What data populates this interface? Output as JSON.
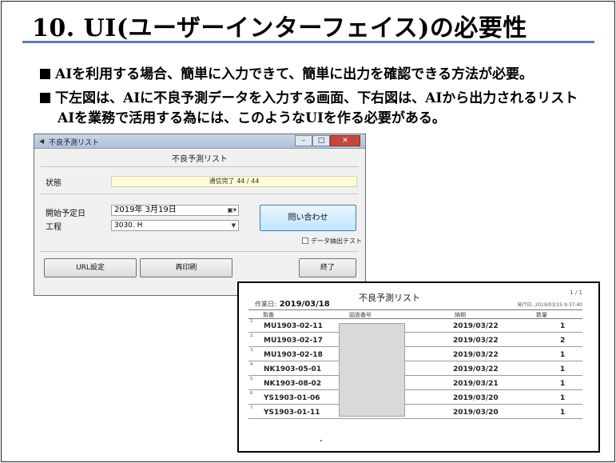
{
  "slide": {
    "title": "10. UI(ユーザーインターフェイス)の必要性",
    "bullets": [
      "AIを利用する場合、簡単に入力できて、簡単に出力を確認できる方法が必要。",
      "下左図は、AIに不良予測データを入力する画面、下右図は、AIから出力されるリスト",
      "AIを業務で活用する為には、このようなUIを作る必要がある。"
    ]
  },
  "window": {
    "title": "不良予測リスト",
    "header": "不良予測リスト",
    "status_label": "状態",
    "status_value": "通信完了 44 / 44",
    "start_date_label": "開始予定日",
    "start_date_value": "2019年  3月19日",
    "process_label": "工程",
    "process_value": "3030. H",
    "query_button": "問い合わせ",
    "test_checkbox": "データ抽出テスト",
    "url_button": "URL設定",
    "reprint_button": "再印刷",
    "end_button": "終了"
  },
  "report": {
    "title": "不良予測リスト",
    "page": "1 / 1",
    "work_date_label": "作業日:",
    "work_date": "2019/03/18",
    "issue_label": "発行日:",
    "issue_date": "2019/03/15 9:37:40",
    "columns": [
      "製番",
      "図面番号",
      "納期",
      "数量"
    ],
    "rows": [
      {
        "no": "1.",
        "part": "MU1903-02-11",
        "due": "2019/03/22",
        "qty": "1"
      },
      {
        "no": "2.",
        "part": "MU1903-02-17",
        "due": "2019/03/22",
        "qty": "2"
      },
      {
        "no": "3.",
        "part": "MU1903-02-18",
        "due": "2019/03/22",
        "qty": "1"
      },
      {
        "no": "4.",
        "part": "NK1903-05-01",
        "due": "2019/03/22",
        "qty": "1"
      },
      {
        "no": "5.",
        "part": "NK1903-08-02",
        "due": "2019/03/21",
        "qty": "1"
      },
      {
        "no": "6.",
        "part": "YS1903-01-06",
        "due": "2019/03/20",
        "qty": "1"
      },
      {
        "no": "7.",
        "part": "YS1903-01-11",
        "due": "2019/03/20",
        "qty": "1"
      }
    ]
  }
}
